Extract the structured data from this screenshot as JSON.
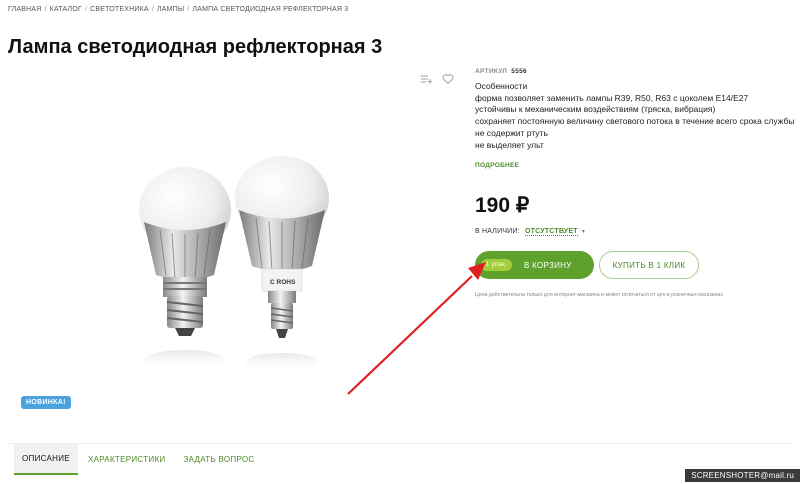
{
  "breadcrumb": {
    "items": [
      "ГЛАВНАЯ",
      "КАТАЛОГ",
      "СВЕТОТЕХНИКА",
      "ЛАМПЫ",
      "ЛАМПА СВЕТОДИОДНАЯ РЕФЛЕКТОРНАЯ 3"
    ],
    "separator": "/"
  },
  "product": {
    "title": "Лампа светодиодная рефлекторная 3",
    "article_label": "АРТИКУЛ",
    "article_value": "5556",
    "features": [
      "Особенности",
      "форма позволяет заменить лампы R39, R50, R63 с цоколем E14/E27",
      "устойчивы к механическим воздействиям (тряска, вибрация)",
      "сохраняет постоянную величину светового потока в течение всего срока службы",
      "не содержит ртуть",
      "не выделяет ульт"
    ],
    "more_link": "ПОДРОБНЕЕ",
    "price": "190 ₽",
    "stock_label": "В НАЛИЧИИ:",
    "stock_status": "ОТСУТСТВУЕТ",
    "badge": "НОВИНКА!",
    "bulb_marking": "C ROHS"
  },
  "buttons": {
    "pack_label": "1 упак.",
    "cart_label": "В КОРЗИНУ",
    "one_click_label": "КУПИТЬ В 1 КЛИК"
  },
  "disclaimer": "Цена действительна только для интернет-магазина и может отличаться от цен в розничных магазинах",
  "tabs": [
    {
      "label": "ОПИСАНИЕ",
      "active": true
    },
    {
      "label": "ХАРАКТЕРИСТИКИ",
      "active": false
    },
    {
      "label": "ЗАДАТЬ ВОПРОС",
      "active": false
    }
  ],
  "watermark": "SCREENSHOTER@mail.ru",
  "icons": [
    "compare-icon",
    "favorite-heart-icon",
    "chevron-down-icon"
  ],
  "colors": {
    "accent_green": "#5ea12c",
    "pack_badge": "#a3cd3c",
    "badge_blue": "#4aa3df",
    "annotation_arrow": "#e02020"
  }
}
